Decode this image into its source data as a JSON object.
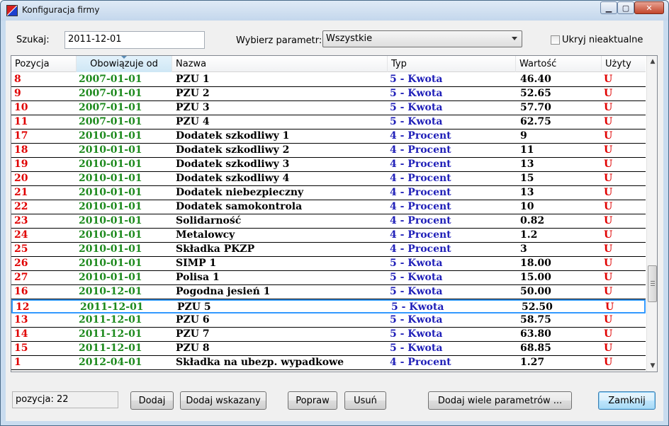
{
  "window": {
    "title": "Konfiguracja firmy"
  },
  "filters": {
    "search_label": "Szukaj:",
    "search_value": "2011-12-01",
    "param_label": "Wybierz parametr:",
    "param_selected": "Wszystkie",
    "hide_outdated_label": "Ukryj nieaktualne",
    "hide_outdated_checked": false
  },
  "table": {
    "columns": [
      "Pozycja",
      "Obowiązuje od",
      "Nazwa",
      "Typ",
      "Wartość",
      "Użyty"
    ],
    "sorted_column": "Obowiązuje od",
    "selected_row_position": "12",
    "rows": [
      {
        "pos": "8",
        "date": "2007-01-01",
        "name": "PZU 1",
        "type": "5 - Kwota",
        "value": "46.40",
        "used": "U"
      },
      {
        "pos": "9",
        "date": "2007-01-01",
        "name": "PZU 2",
        "type": "5 - Kwota",
        "value": "52.65",
        "used": "U"
      },
      {
        "pos": "10",
        "date": "2007-01-01",
        "name": "PZU 3",
        "type": "5 - Kwota",
        "value": "57.70",
        "used": "U"
      },
      {
        "pos": "11",
        "date": "2007-01-01",
        "name": "PZU 4",
        "type": "5 - Kwota",
        "value": "62.75",
        "used": "U"
      },
      {
        "pos": "17",
        "date": "2010-01-01",
        "name": "Dodatek szkodliwy 1",
        "type": "4 - Procent",
        "value": "9",
        "used": "U"
      },
      {
        "pos": "18",
        "date": "2010-01-01",
        "name": "Dodatek szkodliwy 2",
        "type": "4 - Procent",
        "value": "11",
        "used": "U"
      },
      {
        "pos": "19",
        "date": "2010-01-01",
        "name": "Dodatek szkodliwy 3",
        "type": "4 - Procent",
        "value": "13",
        "used": "U"
      },
      {
        "pos": "20",
        "date": "2010-01-01",
        "name": "Dodatek szkodliwy 4",
        "type": "4 - Procent",
        "value": "15",
        "used": "U"
      },
      {
        "pos": "21",
        "date": "2010-01-01",
        "name": "Dodatek niebezpieczny",
        "type": "4 - Procent",
        "value": "13",
        "used": "U"
      },
      {
        "pos": "22",
        "date": "2010-01-01",
        "name": "Dodatek samokontrola",
        "type": "4 - Procent",
        "value": "10",
        "used": "U"
      },
      {
        "pos": "23",
        "date": "2010-01-01",
        "name": "Solidarność",
        "type": "4 - Procent",
        "value": "0.82",
        "used": "U"
      },
      {
        "pos": "24",
        "date": "2010-01-01",
        "name": "Metalowcy",
        "type": "4 - Procent",
        "value": "1.2",
        "used": "U"
      },
      {
        "pos": "25",
        "date": "2010-01-01",
        "name": "Składka PKZP",
        "type": "4 - Procent",
        "value": "3",
        "used": "U"
      },
      {
        "pos": "26",
        "date": "2010-01-01",
        "name": "SIMP 1",
        "type": "5 - Kwota",
        "value": "18.00",
        "used": "U"
      },
      {
        "pos": "27",
        "date": "2010-01-01",
        "name": "Polisa 1",
        "type": "5 - Kwota",
        "value": "15.00",
        "used": "U"
      },
      {
        "pos": "16",
        "date": "2010-12-01",
        "name": "Pogodna jesień 1",
        "type": "5 - Kwota",
        "value": "50.00",
        "used": "U"
      },
      {
        "pos": "12",
        "date": "2011-12-01",
        "name": "PZU 5",
        "type": "5 - Kwota",
        "value": "52.50",
        "used": "U"
      },
      {
        "pos": "13",
        "date": "2011-12-01",
        "name": "PZU 6",
        "type": "5 - Kwota",
        "value": "58.75",
        "used": "U"
      },
      {
        "pos": "14",
        "date": "2011-12-01",
        "name": "PZU 7",
        "type": "5 - Kwota",
        "value": "63.80",
        "used": "U"
      },
      {
        "pos": "15",
        "date": "2011-12-01",
        "name": "PZU 8",
        "type": "5 - Kwota",
        "value": "68.85",
        "used": "U"
      },
      {
        "pos": "1",
        "date": "2012-04-01",
        "name": "Składka na ubezp. wypadkowe",
        "type": "4 - Procent",
        "value": "1.27",
        "used": "U"
      }
    ]
  },
  "colors": {
    "position": "#e00000",
    "date": "#1d8a1d",
    "type": "#1f1fb8",
    "used": "#e00000",
    "selection": "#3399ff"
  },
  "footer": {
    "status_text": "pozycja:  22",
    "buttons": {
      "add": "Dodaj",
      "add_selected": "Dodaj wskazany",
      "edit": "Popraw",
      "delete": "Usuń",
      "add_many": "Dodaj wiele parametrów ...",
      "close": "Zamknij"
    }
  }
}
